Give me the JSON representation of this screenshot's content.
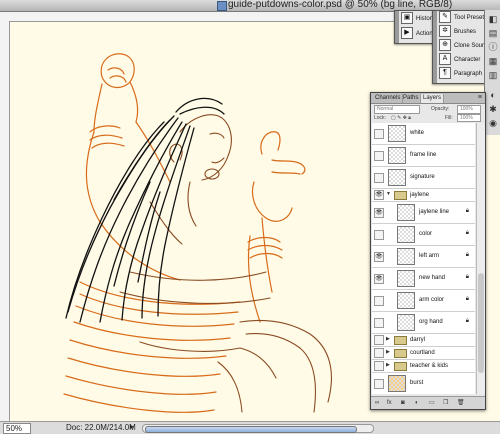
{
  "window": {
    "title": "guide-putdowns-color.psd @ 50% (bg line, RGB/8)"
  },
  "palette_panel_1": {
    "items": [
      {
        "label": "History",
        "icon": "history-icon"
      },
      {
        "label": "Actions",
        "icon": "actions-icon"
      }
    ]
  },
  "palette_panel_2": {
    "items": [
      {
        "label": "Tool Presets",
        "icon": "tool-presets-icon"
      },
      {
        "label": "Brushes",
        "icon": "brushes-icon"
      },
      {
        "label": "Clone Source",
        "icon": "clone-source-icon"
      },
      {
        "label": "Character",
        "icon": "character-icon"
      },
      {
        "label": "Paragraph",
        "icon": "paragraph-icon"
      }
    ]
  },
  "layers_panel": {
    "tabs": [
      "Channels",
      "Paths",
      "Layers"
    ],
    "active_tab": "Layers",
    "blend_mode": "Normal",
    "opacity_label": "Opacity:",
    "opacity_value": "100%",
    "lock_label": "Lock:",
    "fill_label": "Fill:",
    "fill_value": "100%",
    "layers": [
      {
        "name": "white",
        "visible": false,
        "type": "layer",
        "indent": 0
      },
      {
        "name": "frame line",
        "visible": false,
        "type": "layer",
        "indent": 0
      },
      {
        "name": "signature",
        "visible": false,
        "type": "layer",
        "indent": 0
      },
      {
        "name": "jaylene",
        "visible": true,
        "type": "group",
        "expanded": true,
        "indent": 0
      },
      {
        "name": "jaylene line",
        "visible": true,
        "type": "layer",
        "indent": 1,
        "locked": true
      },
      {
        "name": "color",
        "visible": false,
        "type": "layer",
        "indent": 1,
        "locked": true
      },
      {
        "name": "left arm",
        "visible": true,
        "type": "layer",
        "indent": 1,
        "locked": true
      },
      {
        "name": "new hand",
        "visible": true,
        "type": "layer",
        "indent": 1,
        "locked": true
      },
      {
        "name": "arm color",
        "visible": false,
        "type": "layer",
        "indent": 1,
        "locked": true
      },
      {
        "name": "org hand",
        "visible": false,
        "type": "layer",
        "indent": 1,
        "locked": true
      },
      {
        "name": "darryl",
        "visible": false,
        "type": "group",
        "expanded": false,
        "indent": 0
      },
      {
        "name": "courtland",
        "visible": false,
        "type": "group",
        "expanded": false,
        "indent": 0
      },
      {
        "name": "teacher & kids",
        "visible": false,
        "type": "group",
        "expanded": false,
        "indent": 0
      },
      {
        "name": "burst",
        "visible": false,
        "type": "layer",
        "indent": 0
      },
      {
        "name": "bg line",
        "visible": false,
        "type": "layer",
        "indent": 0,
        "selected": true,
        "locked": true
      }
    ]
  },
  "status_bar": {
    "zoom": "50%",
    "doc_info": "Doc: 22.0M/214.0M"
  },
  "colors": {
    "canvas_bg": "#fffbe6",
    "sketch_orange": "#d86b1a",
    "sketch_brown": "#8a4b22",
    "ink": "#111111",
    "selected_row": "#b6c8e2"
  }
}
